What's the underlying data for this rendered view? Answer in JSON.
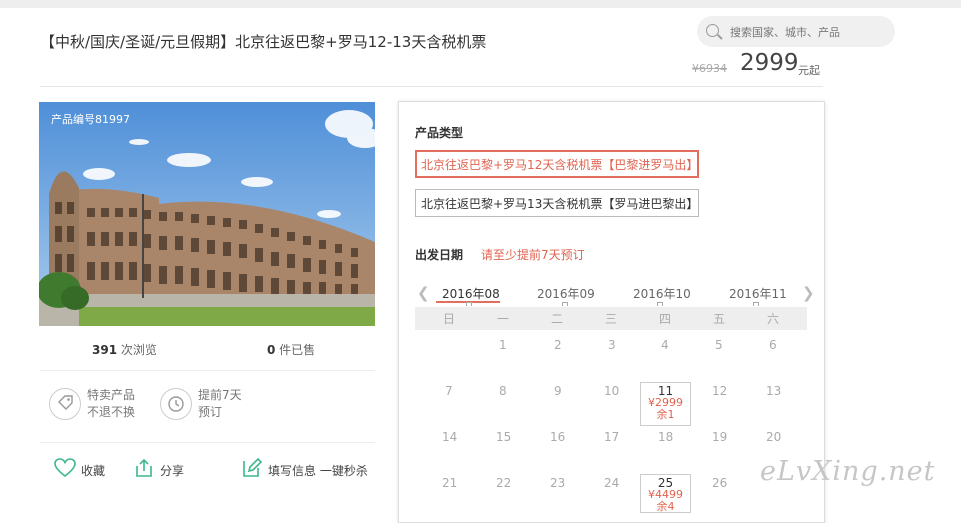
{
  "title": "【中秋/国庆/圣诞/元旦假期】北京往返巴黎+罗马12-13天含税机票",
  "search": {
    "placeholder": "搜索国家、城市、产品"
  },
  "price": {
    "original": "¥6934",
    "current": "2999",
    "unit": "元起"
  },
  "product": {
    "code": "产品编号81997"
  },
  "stats": {
    "views_num": "391",
    "views_label": " 次浏览",
    "sold_num": "0",
    "sold_label": " 件已售"
  },
  "features": [
    {
      "line1": "特卖产品",
      "line2": "不退不换"
    },
    {
      "line1": "提前7天",
      "line2": "预订"
    }
  ],
  "actions": {
    "favorite": "收藏",
    "share": "分享",
    "fill": "填写信息 一键秒杀"
  },
  "booking": {
    "type_label": "产品类型",
    "options": [
      "北京往返巴黎+罗马12天含税机票【巴黎进罗马出】",
      "北京往返巴黎+罗马13天含税机票【罗马进巴黎出】"
    ],
    "date_label": "出发日期",
    "date_note": "请至少提前7天预订",
    "months": [
      "2016年08",
      "2016年09",
      "2016年10",
      "2016年11"
    ],
    "weekdays": [
      "日",
      "一",
      "二",
      "三",
      "四",
      "五",
      "六"
    ],
    "rows": [
      [
        "",
        "1",
        "2",
        "3",
        "4",
        "5",
        "6"
      ],
      [
        "7",
        "8",
        "9",
        "10",
        "11",
        "12",
        "13"
      ],
      [
        "14",
        "15",
        "16",
        "17",
        "18",
        "19",
        "20"
      ],
      [
        "21",
        "22",
        "23",
        "24",
        "25",
        "26",
        ""
      ]
    ],
    "available": [
      {
        "day": "11",
        "price": "¥2999",
        "remain": "余1"
      },
      {
        "day": "25",
        "price": "¥4499",
        "remain": "余4"
      }
    ]
  },
  "watermark": "eLvXing.net",
  "colors": {
    "accent": "#e06450",
    "green_icon": "#3cb88a",
    "weekday_bg": "#eeeeee"
  }
}
